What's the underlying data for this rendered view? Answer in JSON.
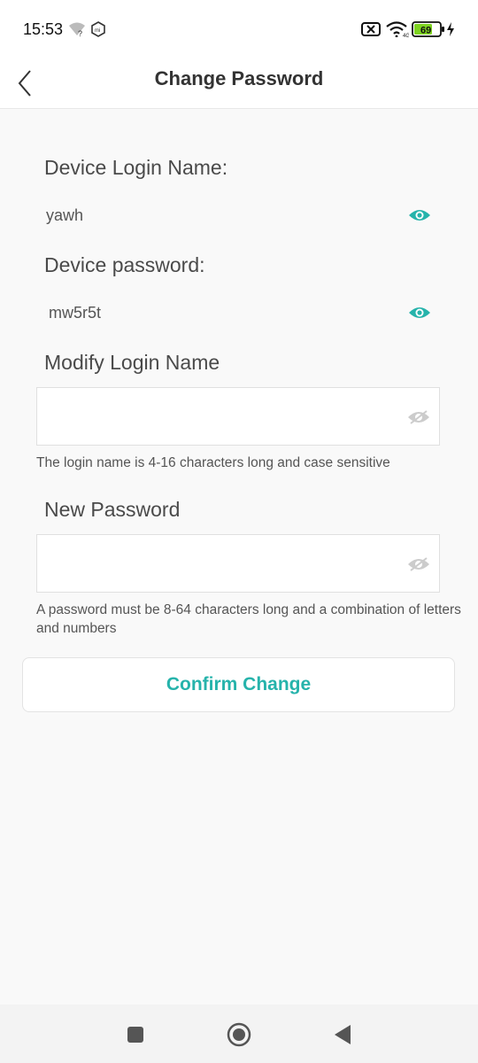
{
  "status_bar": {
    "time": "15:53",
    "battery": "69",
    "icons": [
      "wifi-question-icon",
      "mi-icon",
      "sim-off-icon",
      "wifi-icon",
      "battery-icon",
      "charging-icon"
    ]
  },
  "header": {
    "title": "Change Password",
    "back_icon": "chevron-left-icon"
  },
  "device_login": {
    "label": "Device Login Name:",
    "value": "yawh"
  },
  "device_password": {
    "label": "Device password:",
    "value": "mw5r5t"
  },
  "modify_login": {
    "label": "Modify Login Name",
    "value": "",
    "placeholder": "",
    "hint": "The login name is 4-16 characters long and case sensitive"
  },
  "new_password": {
    "label": "New Password",
    "value": "",
    "placeholder": "",
    "hint": "A password must be 8-64 characters long and a combination of letters and numbers"
  },
  "confirm_label": "Confirm Change",
  "colors": {
    "accent": "#26b3ab",
    "background": "#f9f9f9"
  },
  "nav_bar": {
    "icons": [
      "recents-square-icon",
      "home-circle-icon",
      "back-triangle-icon"
    ]
  }
}
